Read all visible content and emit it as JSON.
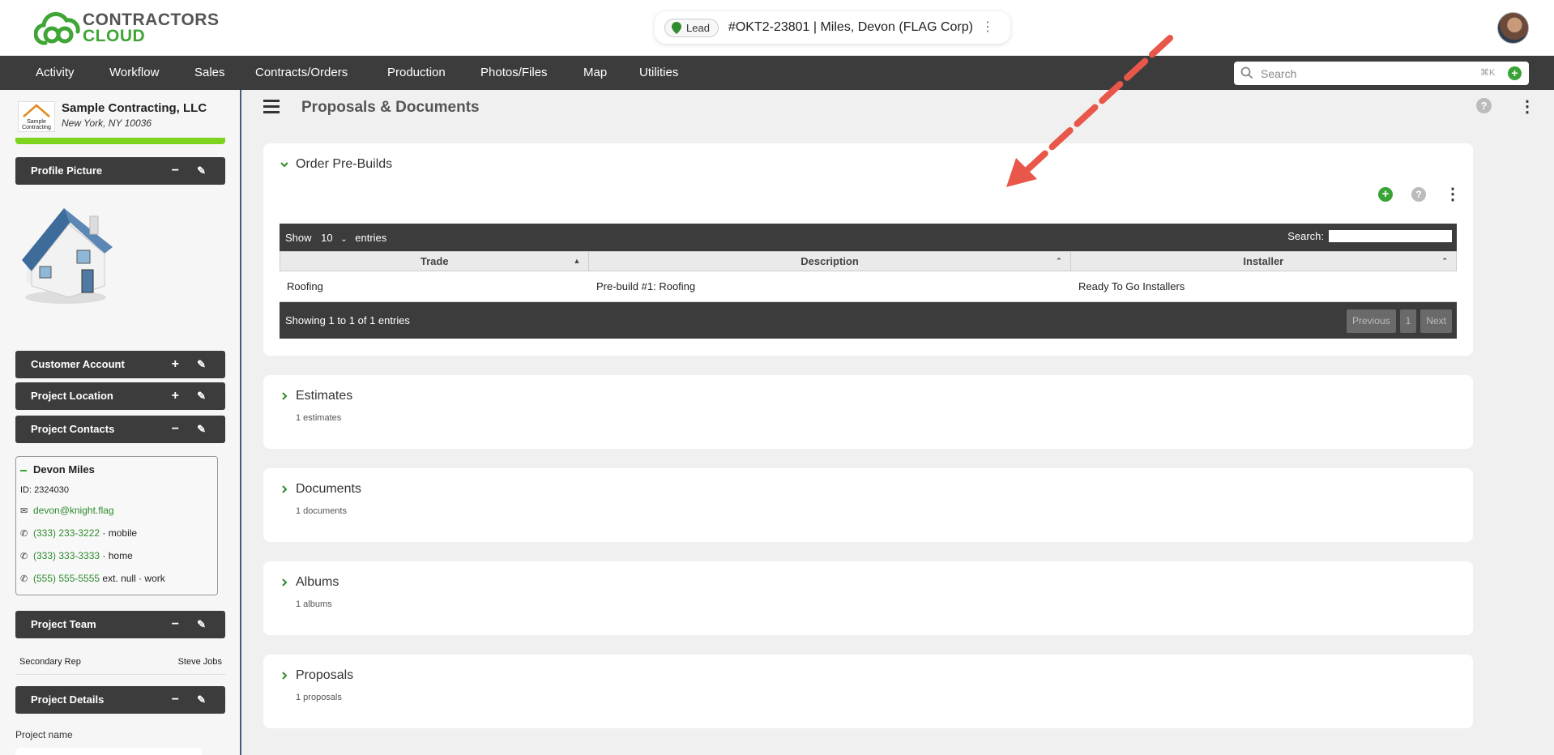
{
  "header": {
    "logo": {
      "line1": "CONTRACTORS",
      "line2": "CLOUD"
    },
    "lead": {
      "badge": "Lead",
      "title": "#OKT2-23801 | Miles, Devon (FLAG Corp)"
    }
  },
  "nav": {
    "items": [
      "Activity",
      "Workflow",
      "Sales",
      "Contracts/Orders",
      "Production",
      "Photos/Files",
      "Map",
      "Utilities"
    ],
    "search_placeholder": "Search",
    "search_shortcut": "⌘K"
  },
  "sidebar": {
    "company": {
      "name": "Sample Contracting, LLC",
      "location": "New York, NY 10036",
      "logo_text1": "Sample",
      "logo_text2": "Contracting"
    },
    "sections": {
      "profile_picture": "Profile Picture",
      "customer_account": "Customer Account",
      "project_location": "Project Location",
      "project_contacts": "Project Contacts",
      "project_team": "Project Team",
      "project_details": "Project Details"
    },
    "contact": {
      "name": "Devon Miles",
      "id": "ID: 2324030",
      "email": "devon@knight.flag",
      "phones": [
        {
          "number": "(333) 233-3222",
          "suffix": " · mobile"
        },
        {
          "number": "(333) 333-3333",
          "suffix": " · home"
        },
        {
          "number": "(555) 555-5555",
          "suffix": " ext. null · work"
        }
      ]
    },
    "team": {
      "role": "Secondary Rep",
      "person": "Steve Jobs"
    },
    "details": {
      "field_label": "Project name"
    }
  },
  "main": {
    "title": "Proposals & Documents",
    "prebuilds": {
      "title": "Order Pre-Builds",
      "show_label": "Show",
      "show_value": "10",
      "entries_label": "entries",
      "search_label": "Search:",
      "columns": [
        "Trade",
        "Description",
        "Installer"
      ],
      "rows": [
        [
          "Roofing",
          "Pre-build #1: Roofing",
          "Ready To Go Installers"
        ]
      ],
      "info": "Showing 1 to 1 of 1 entries",
      "pagination": {
        "previous": "Previous",
        "page": "1",
        "next": "Next"
      }
    },
    "sections": [
      {
        "title": "Estimates",
        "count": "1 estimates"
      },
      {
        "title": "Documents",
        "count": "1 documents"
      },
      {
        "title": "Albums",
        "count": "1 albums"
      },
      {
        "title": "Proposals",
        "count": "1 proposals"
      }
    ]
  },
  "colors": {
    "accent": "#3aa335",
    "dark": "#3c3c3c",
    "arrow": "#e8574a",
    "progress": "#7ed31f"
  }
}
